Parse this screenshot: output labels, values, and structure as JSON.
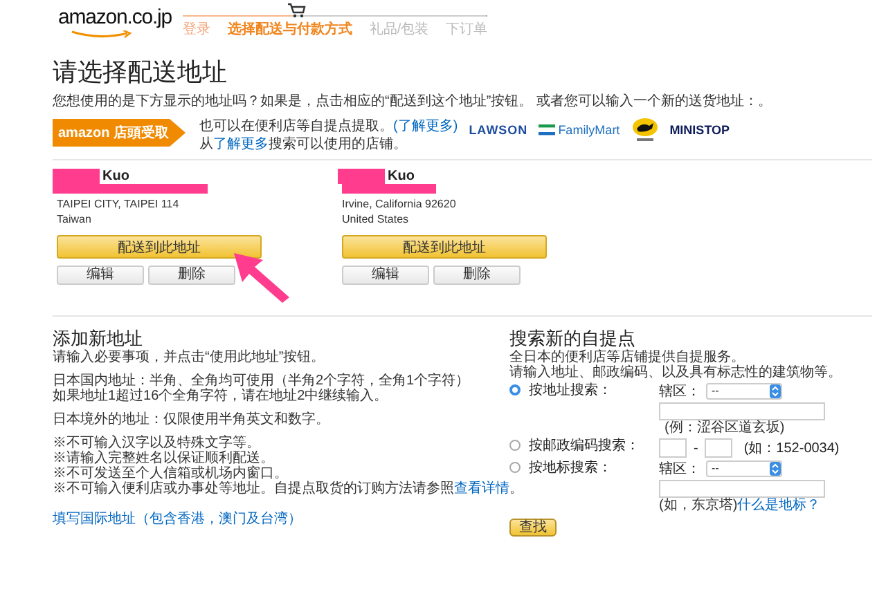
{
  "header": {
    "logo": "amazon.co.jp",
    "steps": [
      {
        "label": "登录",
        "selected": false,
        "completed": true
      },
      {
        "label": "选择配送与付款方式",
        "selected": true,
        "completed": false
      },
      {
        "label": "礼品/包装",
        "selected": false,
        "completed": false
      },
      {
        "label": "下订单",
        "selected": false,
        "completed": false
      }
    ]
  },
  "page_title": "请选择配送地址",
  "intro": "您想使用的是下方显示的地址吗？如果是，点击相应的“配送到这个地址”按钮。 或者您可以输入一个新的送货地址：。",
  "pickup": {
    "badge": "amazon 店頭受取",
    "line_1": {
      "text": "也可以在便利店等自提点提取。",
      "link": "(了解更多)"
    },
    "line_2": {
      "before": "从",
      "link": "了解更多",
      "after": "搜索可以使用的店铺。"
    },
    "stores": [
      "LAWSON",
      "FamilyMart",
      "MINISTOP"
    ]
  },
  "addresses": [
    {
      "name": "Kuo",
      "line": "TAIPEI CITY, TAIPEI 114",
      "country": "Taiwan",
      "ship_button": "配送到此地址",
      "edit_button": "编辑",
      "delete_button": "删除"
    },
    {
      "name": "Kuo",
      "line": "Irvine, California 92620",
      "country": "United States",
      "ship_button": "配送到此地址",
      "edit_button": "编辑",
      "delete_button": "删除"
    }
  ],
  "new_address": {
    "title": "添加新地址",
    "groups": [
      [
        {
          "text": "请输入必要事项，并点击“使用此地址”按钮。"
        }
      ],
      [
        {
          "text": "日本国内地址：半角、全角均可使用（半角2个字符，全角1个字符）"
        },
        {
          "text": "如果地址1超过16个全角字符，请在地址2中继续输入。"
        }
      ],
      [
        {
          "text": "日本境外的地址：仅限使用半角英文和数字。"
        }
      ],
      [
        {
          "text": "※不可输入汉字以及特殊文字等。"
        },
        {
          "text": "※请输入完整姓名以保证顺利配送。"
        },
        {
          "text": "※不可发送至个人信箱或机场内窗口。"
        },
        {
          "text": "※不可输入便利店或办事处等地址。自提点取货的订购方法请参照",
          "link": "查看详情",
          "after": "。"
        }
      ]
    ],
    "intl_link": "填写国际地址（包含香港，澳门及台湾）"
  },
  "pickup_search": {
    "title": "搜索新的自提点",
    "lines": [
      "全日本的便利店等店铺提供自提服务。",
      "请输入地址、邮政编码、以及具有标志性的建筑物等。"
    ],
    "options": [
      {
        "kind": "address",
        "label": "按地址搜索：",
        "selected": true,
        "region_label": "辖区：",
        "region_value": "--",
        "hint": "(例：涩谷区道玄坂)"
      },
      {
        "kind": "postal",
        "label": "按邮政编码搜索：",
        "selected": false,
        "separator": "-",
        "hint": "(如：152-0034)"
      },
      {
        "kind": "landmark",
        "label": "按地标搜索：",
        "selected": false,
        "region_label": "辖区：",
        "region_value": "--",
        "hint": "(如，东京塔)",
        "hint_link": "什么是地标？"
      }
    ],
    "button": "查找"
  }
}
